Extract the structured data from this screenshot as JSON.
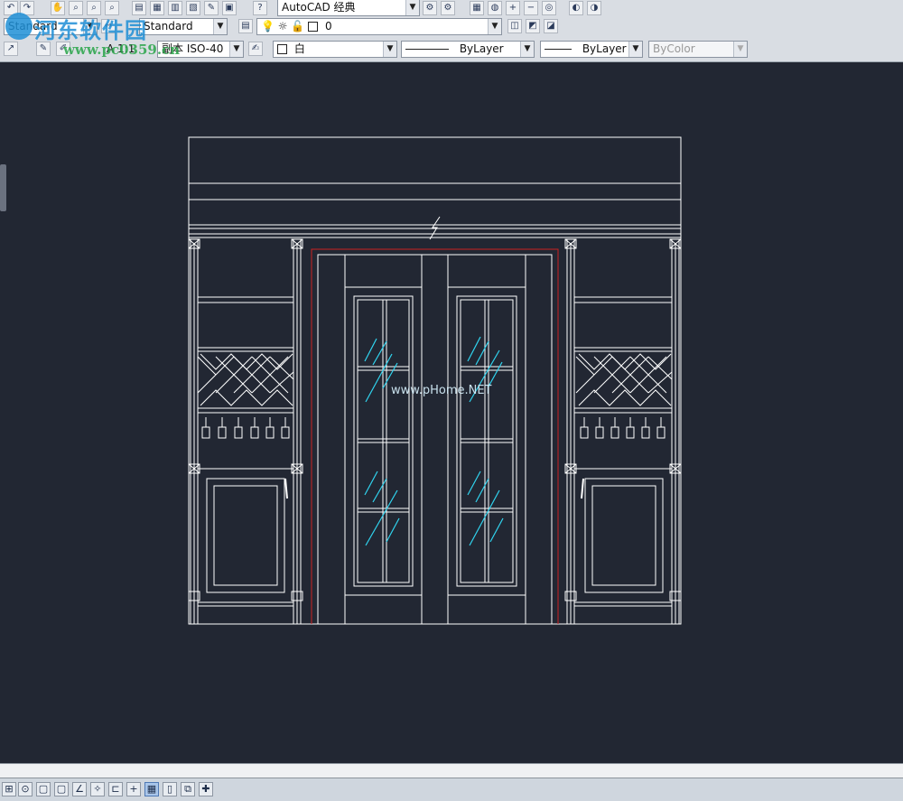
{
  "toolbar_top": {
    "workspace_value": "AutoCAD 经典",
    "icons": [
      "undo-icon",
      "redo-icon",
      "pan-icon",
      "zoom-realtime-icon",
      "zoom-window-icon",
      "zoom-previous-icon",
      "properties-icon",
      "design-center-icon",
      "tool-palettes-icon",
      "sheet-set-icon",
      "markup-icon",
      "calculator-icon",
      "help-icon",
      "workspace-settings-icon",
      "customize-icon",
      "viewport-icon",
      "sphere-icon",
      "plus-icon",
      "minus-icon",
      "orbit-icon",
      "render-icon"
    ]
  },
  "toolbar_styles": {
    "text_style": "Standard",
    "dim_style": "Standard",
    "layer_value": "0",
    "icons": [
      "layer-manager-icon",
      "layer-on-icon",
      "freeze-icon",
      "lock-icon",
      "layer-previous-icon",
      "layer-states-icon",
      "layer-match-icon"
    ]
  },
  "toolbar_properties": {
    "annotation_scale_label": "A 1:1",
    "multileader_style": "副本 ISO-40",
    "color_value": "白",
    "linetype_value": "ByLayer",
    "lineweight_value": "ByLayer",
    "plotstyle_value": "ByColor"
  },
  "watermark": {
    "site_name": "河东软件园",
    "site_url": "www.pc0359.cn",
    "drawing_text": "www.pHome.NET"
  },
  "colors": {
    "canvas_bg": "#222733",
    "line_white": "#ffffff",
    "line_red": "#cc2020",
    "line_cyan": "#30d5f0"
  },
  "status_bar": {
    "buttons": [
      "snap-mode-icon",
      "grid-icon",
      "ortho-icon",
      "polar-icon",
      "osnap-icon",
      "otrack-icon",
      "ducs-icon",
      "dyn-icon",
      "lineweight-icon",
      "quick-properties-icon",
      "selection-cycling-icon",
      "model-icon"
    ]
  }
}
